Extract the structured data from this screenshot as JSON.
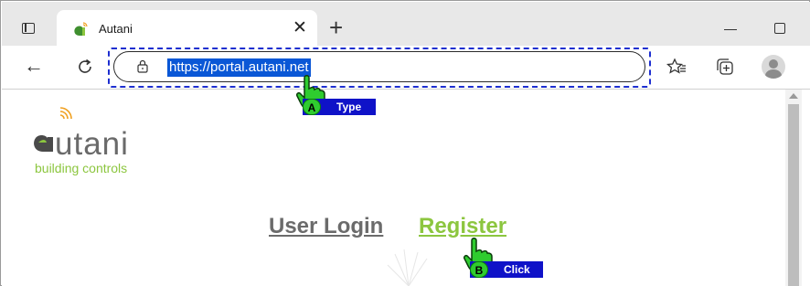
{
  "tab": {
    "title": "Autani"
  },
  "toolbar": {
    "url": "https://portal.autani.net"
  },
  "page": {
    "logo_word": "utani",
    "logo_sub": "building controls",
    "login_link": "User Login",
    "register_link": "Register"
  },
  "annotations": [
    {
      "letter": "A",
      "action": "Type"
    },
    {
      "letter": "B",
      "action": "Click"
    }
  ],
  "icons": {
    "tab_actions": "tab-actions-icon",
    "close": "close-icon",
    "new_tab": "plus-icon",
    "back": "back-arrow-icon",
    "refresh": "refresh-icon",
    "lock": "lock-icon",
    "favorites": "favorites-icon",
    "collections": "collections-icon",
    "profile": "profile-icon"
  },
  "colors": {
    "brand_green": "#8cc63f",
    "brand_gray": "#6b6b6b",
    "url_selection": "#0a57d6",
    "marker_blue": "#0f12c8",
    "marker_green": "#2fcc2f"
  }
}
